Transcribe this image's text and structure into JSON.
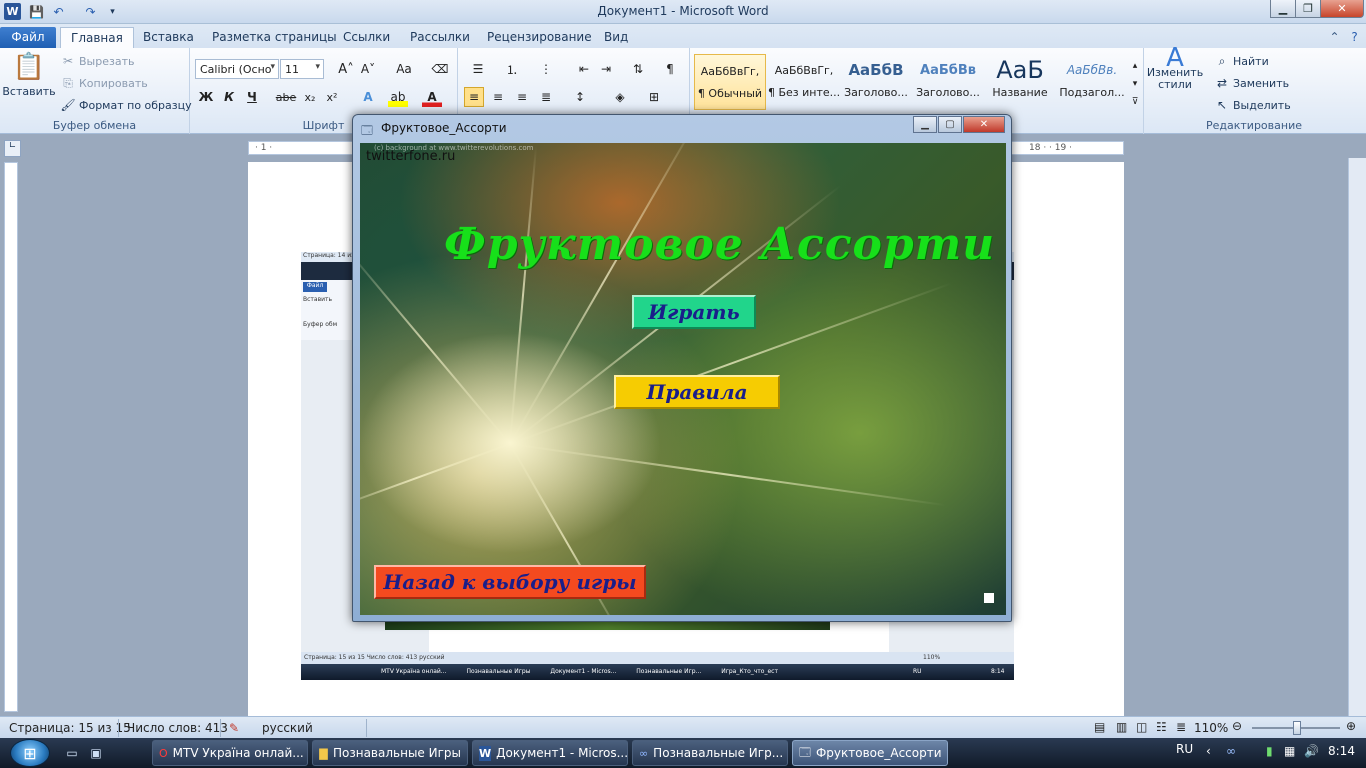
{
  "app": {
    "window_title": "Документ1 - Microsoft Word"
  },
  "tabs": [
    "Файл",
    "Главная",
    "Вставка",
    "Разметка страницы",
    "Ссылки",
    "Рассылки",
    "Рецензирование",
    "Вид"
  ],
  "ribbon": {
    "clipboard": {
      "paste": "Вставить",
      "cut": "Вырезать",
      "copy": "Копировать",
      "format_painter": "Формат по образцу",
      "label": "Буфер обмена"
    },
    "font": {
      "name": "Calibri (Осно",
      "size": "11",
      "label": "Шрифт",
      "bold": "Ж",
      "italic": "К",
      "underline": "Ч",
      "strike": "abe"
    },
    "styles": [
      {
        "preview": "АаБбВвГг,",
        "name": "¶ Обычный"
      },
      {
        "preview": "АаБбВвГг,",
        "name": "¶ Без инте..."
      },
      {
        "preview": "АаБбВ",
        "name": "Заголово..."
      },
      {
        "preview": "АаБбВв",
        "name": "Заголово..."
      },
      {
        "preview": "АаБ",
        "name": "Название"
      },
      {
        "preview": "АаБбВв.",
        "name": "Подзагол..."
      }
    ],
    "change_styles": "Изменить стили",
    "editing": {
      "find": "Найти",
      "replace": "Заменить",
      "select": "Выделить",
      "label": "Редактирование"
    }
  },
  "ruler": {
    "marks_left": "· 1 · ",
    "marks_right": "18 · · 19 ·"
  },
  "embedded": {
    "title": "Страница: 14 из",
    "tab": "Файл",
    "paste": "Вставить",
    "clipboard": "Буфер обм",
    "status": "Страница: 15 из 15    Число слов: 413        русский",
    "zoom": "110%",
    "tasks": [
      "MTV Україна онлай...",
      "Познавальные Игры",
      "Документ1 - Micros...",
      "Познавальные Игр...",
      "Игра_Кто_что_ест"
    ],
    "lang": "RU",
    "time": "8:14"
  },
  "game": {
    "window_title": "Фруктовое_Ассорти",
    "watermark_top": "(c) background at www.twitterevolutions.com",
    "watermark": "twitterfone.ru",
    "title": "Фруктовое Ассорти",
    "play": "Играть",
    "rules": "Правила",
    "back": "Назад к выбору игры"
  },
  "statusbar": {
    "page": "Страница: 15 из 15",
    "words": "Число слов: 413",
    "lang": "русский",
    "zoom": "110%"
  },
  "taskbar": {
    "items": [
      {
        "label": "MTV Україна онлай...",
        "icon": "opera-icon"
      },
      {
        "label": "Познавальные Игры",
        "icon": "folder-icon"
      },
      {
        "label": "Документ1 - Micros...",
        "icon": "word-icon"
      },
      {
        "label": "Познавальные Игр...",
        "icon": "app-icon"
      },
      {
        "label": "Фруктовое_Ассорти",
        "icon": "app-window-icon"
      }
    ],
    "lang": "RU",
    "time": "8:14"
  }
}
